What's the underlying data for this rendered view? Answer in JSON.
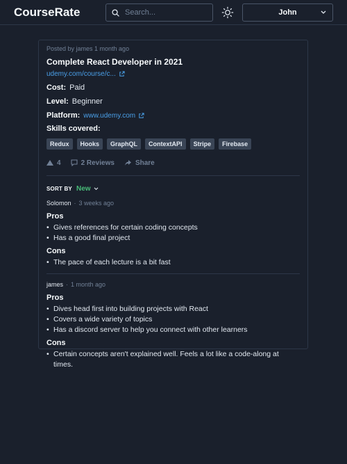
{
  "header": {
    "brand": "CourseRate",
    "search_placeholder": "Search...",
    "user_name": "John"
  },
  "post": {
    "meta": "Posted by james 1 month ago",
    "title": "Complete React Developer in 2021",
    "link_text": "udemy.com/course/c...",
    "cost_label": "Cost:",
    "cost_value": "Paid",
    "level_label": "Level:",
    "level_value": "Beginner",
    "platform_label": "Platform:",
    "platform_value": "www.udemy.com",
    "skills_label": "Skills covered:",
    "skills": [
      "Redux",
      "Hooks",
      "GraphQL",
      "ContextAPI",
      "Stripe",
      "Firebase"
    ],
    "upvotes": "4",
    "reviews_label": "2 Reviews",
    "share_label": "Share"
  },
  "sort": {
    "label": "SORT BY",
    "value": "New"
  },
  "reviews": [
    {
      "author": "Solomon",
      "time": "3 weeks ago",
      "pros_label": "Pros",
      "pros": [
        "Gives references for certain coding concepts",
        "Has a good final project"
      ],
      "cons_label": "Cons",
      "cons": [
        "The pace of each lecture is a bit fast"
      ]
    },
    {
      "author": "james",
      "time": "1 month ago",
      "pros_label": "Pros",
      "pros": [
        "Dives head first into building projects with React",
        "Covers a wide variety of topics",
        "Has a discord server to help you connect with other learners"
      ],
      "cons_label": "Cons",
      "cons": [
        "Certain concepts aren't explained well. Feels a lot like a code-along at times."
      ]
    }
  ],
  "colors": {
    "background": "#1a202c",
    "link": "#4a9fe8",
    "accent_green": "#48bb78",
    "tag_bg": "#3a4556"
  }
}
